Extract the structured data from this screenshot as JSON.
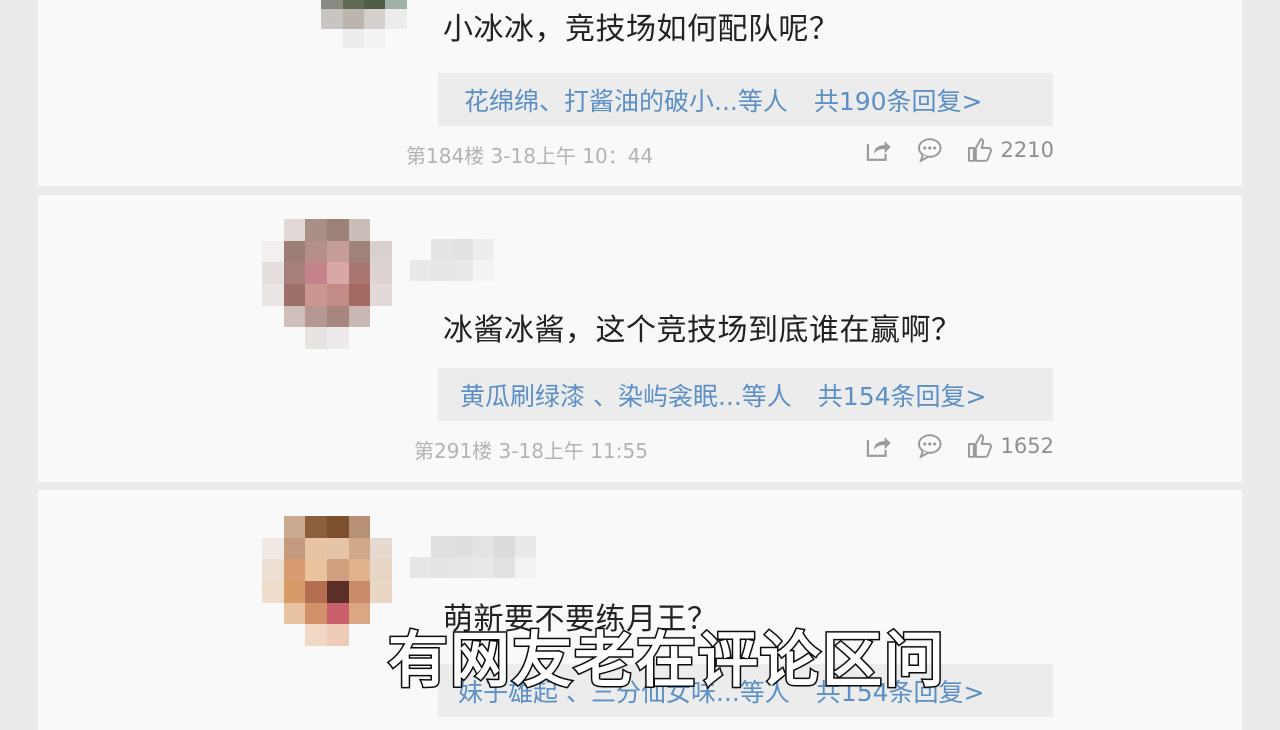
{
  "comments": [
    {
      "text": "小冰冰，竞技场如何配队呢？",
      "reply_names": "花绵绵、打酱油的破小...等人",
      "reply_count": "共190条回复>",
      "meta": "第184楼 3-18上午 10：44",
      "likes": "2210"
    },
    {
      "text": "冰酱冰酱，这个竞技场到底谁在赢啊？",
      "reply_names": "黄瓜刷绿漆 、染屿衾眠...等人",
      "reply_count": "共154条回复>",
      "meta": "第291楼 3-18上午 11:55",
      "likes": "1652"
    },
    {
      "text": "萌新要不要练月王？",
      "reply_names": "妹子雄起 、三分仙女味...等人",
      "reply_count": "共154条回复>"
    }
  ],
  "subtitle": "有网友老在评论区问",
  "icons": {
    "share": "share-icon",
    "reply": "comment-bubble-icon",
    "like": "thumbs-up-icon"
  },
  "colors": {
    "link": "#5b8fc6",
    "meta": "#b3b3b3",
    "card": "#f9f9f9"
  }
}
